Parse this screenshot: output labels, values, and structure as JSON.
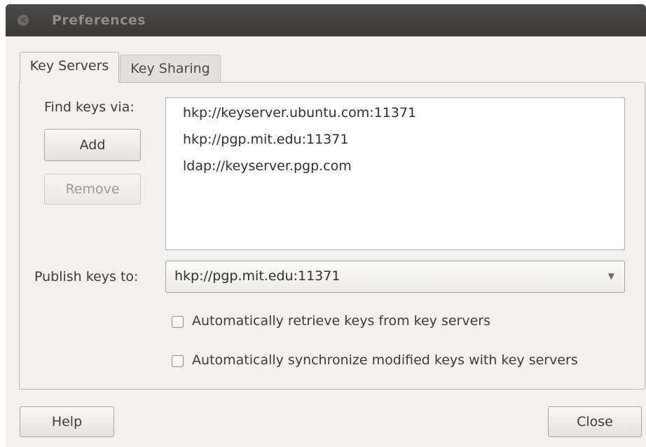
{
  "window": {
    "title": "Preferences"
  },
  "tabs": [
    {
      "label": "Key Servers",
      "active": true
    },
    {
      "label": "Key Sharing",
      "active": false
    }
  ],
  "key_servers": {
    "find_label": "Find keys via:",
    "add_label": "Add",
    "remove_label": "Remove",
    "servers": [
      "hkp://keyserver.ubuntu.com:11371",
      "hkp://pgp.mit.edu:11371",
      "ldap://keyserver.pgp.com"
    ],
    "publish_label": "Publish keys to:",
    "publish_value": "hkp://pgp.mit.edu:11371",
    "auto_retrieve": {
      "label": "Automatically retrieve keys from key servers",
      "checked": false
    },
    "auto_sync": {
      "label": "Automatically synchronize modified keys with key servers",
      "checked": false
    }
  },
  "footer": {
    "help_label": "Help",
    "close_label": "Close"
  },
  "icons": {
    "close": "close-icon",
    "dropdown": "dropdown-arrow-icon"
  },
  "colors": {
    "titlebar": "#3c3b37",
    "window_bg": "#f2f1f0"
  }
}
